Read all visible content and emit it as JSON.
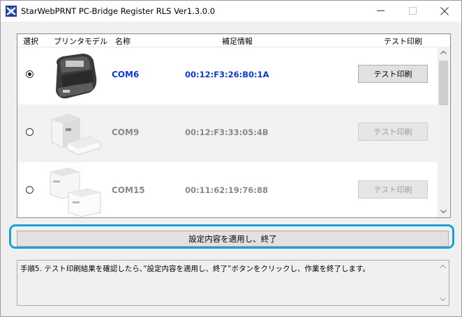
{
  "window": {
    "title": "StarWebPRNT PC-Bridge Register RLS  Ver1.3.0.0",
    "icon": "starweb-app-icon",
    "controls": {
      "minimize": "—",
      "maximize": "☐",
      "close": "✕"
    }
  },
  "table": {
    "headers": {
      "select": "選択",
      "model": "プリンタモデル",
      "name": "名称",
      "info": "補足情報",
      "test": "テスト印刷"
    },
    "rows": [
      {
        "selected": true,
        "image": "portable-printer-image",
        "name": "COM6",
        "info": "00:12:F3:26:B0:1A",
        "test_label": "テスト印刷",
        "test_enabled": true
      },
      {
        "selected": false,
        "image": "receipt-printer-white-image",
        "name": "COM9",
        "info": "00:12:F3:33:05:4B",
        "test_label": "テスト印刷",
        "test_enabled": false
      },
      {
        "selected": false,
        "image": "receipt-printer-cube-image",
        "name": "COM15",
        "info": "00:11:62:19:76:88",
        "test_label": "テスト印刷",
        "test_enabled": false
      }
    ]
  },
  "apply_button": {
    "label": "設定内容を適用し、終了"
  },
  "message": {
    "text": "手順5. テスト印刷結果を確認したら、”設定内容を適用し、終了”ボタンをクリックし、作業を終了します。"
  },
  "colors": {
    "active_text": "#0a3ad6",
    "inactive_text": "#888888",
    "highlight": "#1ba1d6"
  }
}
